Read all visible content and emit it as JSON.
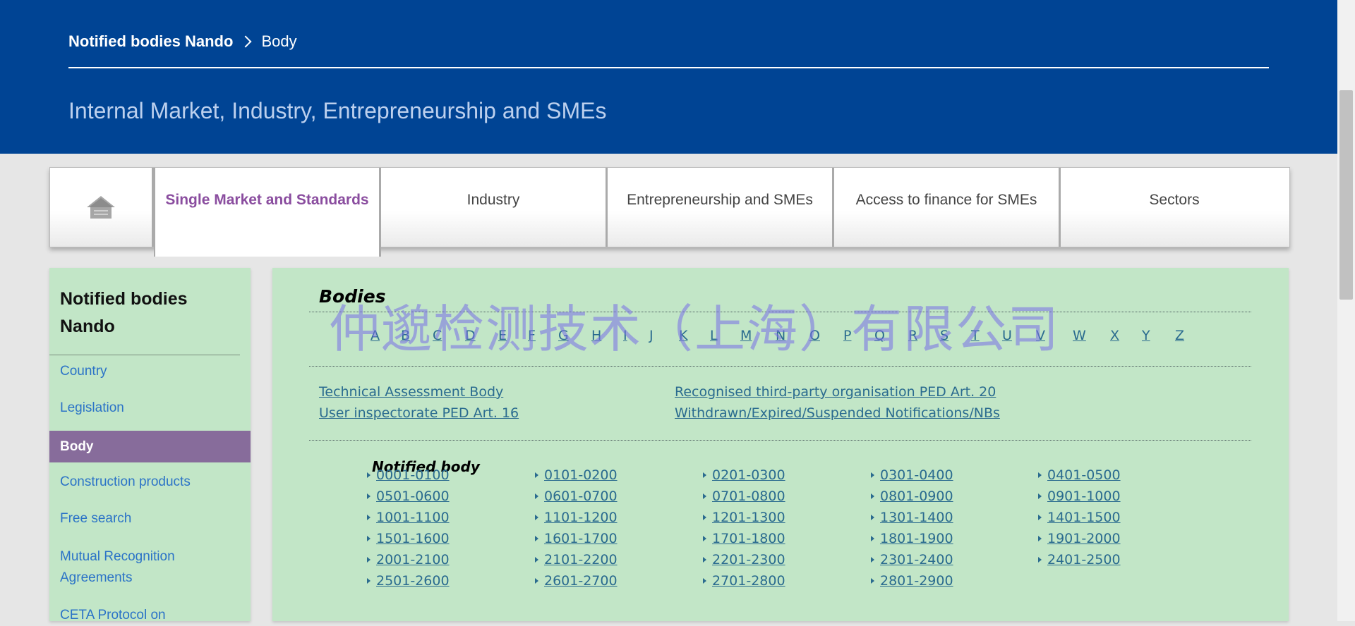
{
  "header": {
    "breadcrumb_root": "Notified bodies Nando",
    "breadcrumb_current": "Body",
    "site_title": "Internal Market, Industry, Entrepreneurship and SMEs"
  },
  "nav": {
    "home_icon": "home-icon",
    "items": [
      {
        "label": "Single Market and Standards",
        "active": true
      },
      {
        "label": "Industry"
      },
      {
        "label": "Entrepreneurship and SMEs"
      },
      {
        "label": "Access to finance for SMEs"
      },
      {
        "label": "Sectors"
      }
    ]
  },
  "sidebar": {
    "title": "Notified bodies Nando",
    "items": [
      {
        "label": "Country"
      },
      {
        "label": "Legislation"
      },
      {
        "label": "Body",
        "active": true
      },
      {
        "label": "Construction products"
      },
      {
        "label": "Free search"
      },
      {
        "label": "Mutual Recognition Agreements"
      },
      {
        "label": "CETA Protocol on"
      }
    ]
  },
  "main": {
    "title": "Bodies",
    "letters": [
      "A",
      "B",
      "C",
      "D",
      "E",
      "F",
      "G",
      "H",
      "I",
      "J",
      "K",
      "L",
      "M",
      "N",
      "O",
      "P",
      "Q",
      "R",
      "S",
      "T",
      "U",
      "V",
      "W",
      "X",
      "Y",
      "Z"
    ],
    "links": {
      "tab": "Technical Assessment Body",
      "user_insp": "User inspectorate PED Art. 16",
      "recognised": "Recognised third-party organisation PED Art. 20",
      "withdrawn": "Withdrawn/Expired/Suspended Notifications/NBs"
    },
    "notified_body_title": "Notified body",
    "ranges": [
      [
        "0001-0100",
        "0101-0200",
        "0201-0300",
        "0301-0400",
        "0401-0500"
      ],
      [
        "0501-0600",
        "0601-0700",
        "0701-0800",
        "0801-0900",
        "0901-1000"
      ],
      [
        "1001-1100",
        "1101-1200",
        "1201-1300",
        "1301-1400",
        "1401-1500"
      ],
      [
        "1501-1600",
        "1601-1700",
        "1701-1800",
        "1801-1900",
        "1901-2000"
      ],
      [
        "2001-2100",
        "2101-2200",
        "2201-2300",
        "2301-2400",
        "2401-2500"
      ],
      [
        "2501-2600",
        "2601-2700",
        "2701-2800",
        "2801-2900"
      ]
    ]
  },
  "watermark": "仲邈检测技术（上海）有限公司",
  "colors": {
    "header_bg": "#004494",
    "panel_bg": "#c2e6c7",
    "active_purple": "#876c9b",
    "link": "#2a6b8f"
  }
}
